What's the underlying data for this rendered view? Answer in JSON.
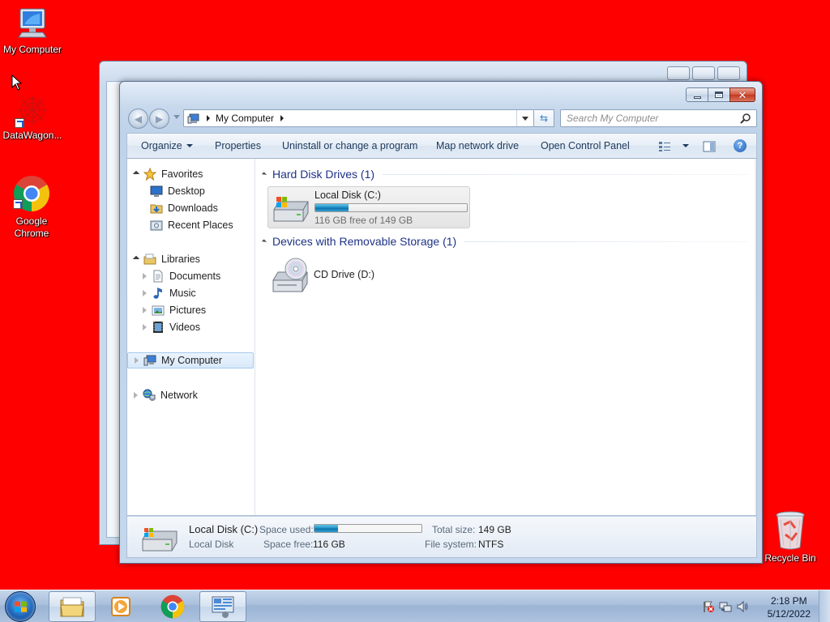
{
  "desktop": {
    "background_color": "#fe0000",
    "icons": [
      {
        "label": "My Computer",
        "icon": "computer-icon"
      },
      {
        "label": "DataWagon...",
        "icon": "datawagon-icon"
      },
      {
        "label": "Google Chrome",
        "icon": "chrome-icon"
      },
      {
        "label": "Recycle Bin",
        "icon": "recycle-bin-icon"
      }
    ]
  },
  "window": {
    "address": {
      "location": "My Computer"
    },
    "search": {
      "placeholder": "Search My Computer"
    },
    "toolbar": {
      "organize": "Organize",
      "properties": "Properties",
      "uninstall": "Uninstall or change a program",
      "map_drive": "Map network drive",
      "control_panel": "Open Control Panel"
    },
    "nav_pane": {
      "favorites": "Favorites",
      "desktop": "Desktop",
      "downloads": "Downloads",
      "recent_places": "Recent Places",
      "libraries": "Libraries",
      "documents": "Documents",
      "music": "Music",
      "pictures": "Pictures",
      "videos": "Videos",
      "my_computer": "My Computer",
      "network": "Network"
    },
    "content": {
      "hard_disk_header": "Hard Disk Drives (1)",
      "removable_header": "Devices with Removable Storage (1)",
      "local_disk": {
        "name": "Local Disk (C:)",
        "free_text": "116 GB free of 149 GB",
        "used_fraction": 0.22
      },
      "cd_drive": {
        "name": "CD Drive (D:)"
      }
    },
    "details": {
      "name": "Local Disk (C:)",
      "type": "Local Disk",
      "space_used_label": "Space used:",
      "space_free_label": "Space free:",
      "space_free_value": "116 GB",
      "total_size_label": "Total size:",
      "total_size_value": "149 GB",
      "file_system_label": "File system:",
      "file_system_value": "NTFS",
      "used_fraction": 0.22
    }
  },
  "taskbar": {
    "time": "2:18 PM",
    "date": "5/12/2022",
    "items": [
      "explorer-icon",
      "media-player-icon",
      "chrome-icon",
      "network-config-icon"
    ]
  }
}
